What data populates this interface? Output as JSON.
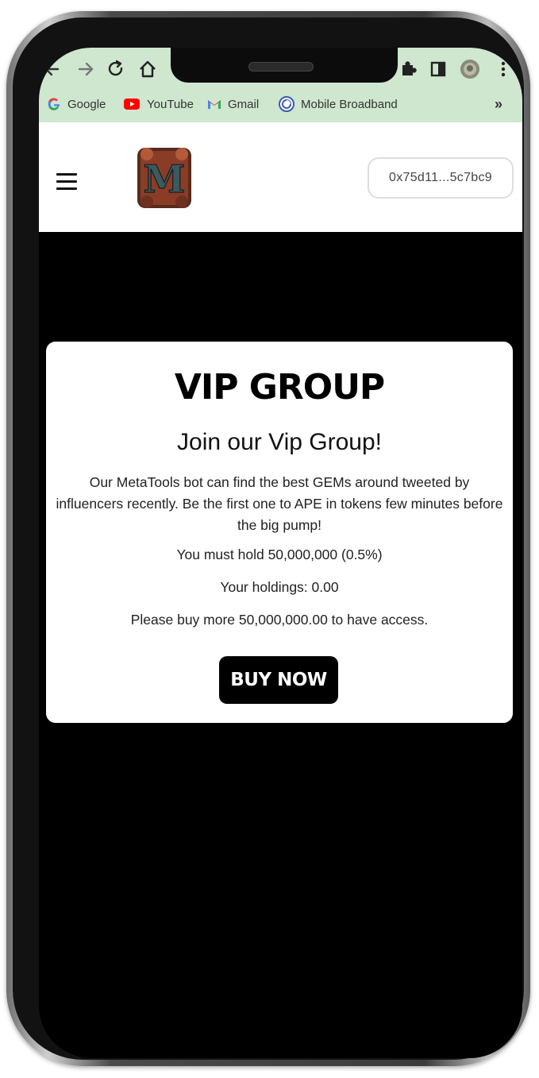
{
  "browser": {
    "bookmarks": [
      {
        "label": "Google",
        "icon": "google-icon"
      },
      {
        "label": "YouTube",
        "icon": "youtube-icon"
      },
      {
        "label": "Gmail",
        "icon": "gmail-icon"
      },
      {
        "label": "Mobile Broadband",
        "icon": "broadband-icon"
      }
    ],
    "more_glyph": "»"
  },
  "header": {
    "wallet_address": "0x75d11...5c7bc9",
    "logo_letter": "M"
  },
  "vip": {
    "title": "VIP GROUP",
    "subtitle": "Join our Vip Group!",
    "description": "Our MetaTools bot can find the best GEMs around tweeted by influencers recently. Be the first one to APE in tokens few minutes before the big pump!",
    "requirement": "You must hold 50,000,000 (0.5%)",
    "holdings": "Your holdings: 0.00",
    "buy_more": "Please buy more 50,000,000.00 to have access.",
    "button_label": "BUY NOW"
  },
  "colors": {
    "browser_bar": "#cfe6cf",
    "page_background": "#000000",
    "card_background": "#ffffff",
    "button_background": "#000000"
  }
}
